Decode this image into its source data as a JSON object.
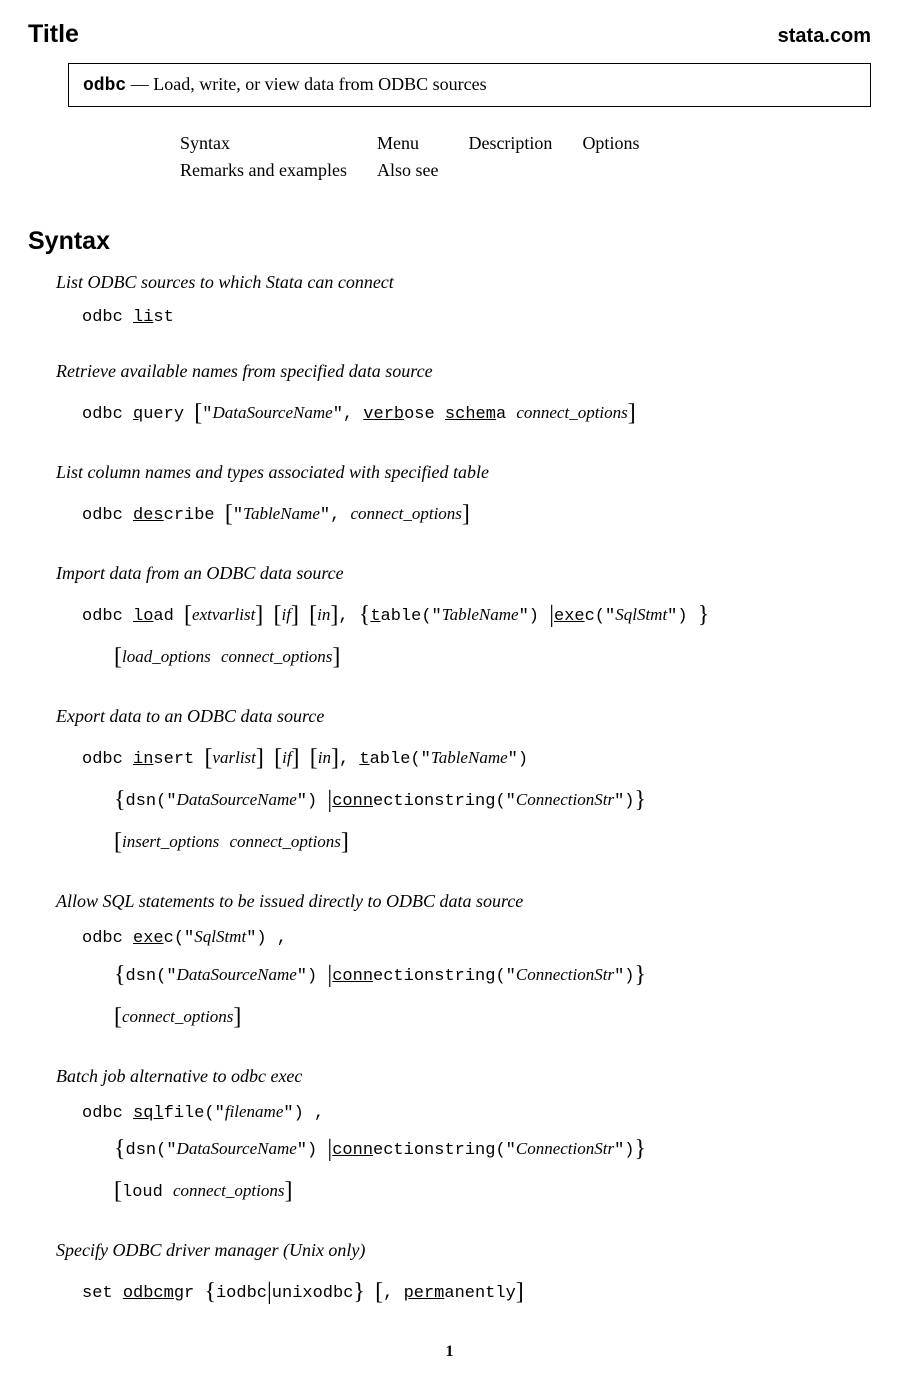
{
  "header": {
    "title": "Title",
    "brand": "stata.com"
  },
  "titleBox": {
    "cmd": "odbc",
    "dash": "—",
    "desc": "Load, write, or view data from ODBC sources"
  },
  "nav": {
    "r1c1": "Syntax",
    "r1c2": "Menu",
    "r1c3": "Description",
    "r1c4": "Options",
    "r2c1": "Remarks and examples",
    "r2c2": "Also see"
  },
  "section": "Syntax",
  "s1": {
    "desc": "List ODBC sources to which Stata can connect",
    "cmd_odbc": "odbc ",
    "cmd_li": "li",
    "cmd_st": "st"
  },
  "s2": {
    "desc": "Retrieve available names from specified data source",
    "odbc": "odbc ",
    "q": "q",
    "uery": "uery ",
    "dsn": "DataSourceName",
    "comma": ", ",
    "verb": "verb",
    "ose": "ose ",
    "schem": "schem",
    "a": "a ",
    "conn": "connect_options"
  },
  "s3": {
    "desc": "List column names and types associated with specified table",
    "odbc": "odbc ",
    "des": "des",
    "cribe": "cribe ",
    "tbl": "TableName",
    "comma": ", ",
    "conn": "connect_options"
  },
  "s4": {
    "desc": "Import data from an ODBC data source",
    "odbc": "odbc ",
    "lo": "lo",
    "ad": "ad ",
    "extv": "extvarlist",
    "if": "if",
    "in": "in",
    "comma": ", ",
    "t": "t",
    "able": "able(",
    "tbl": "TableName",
    "close": ") ",
    "exe": "exe",
    "c": "c(",
    "sql": "SqlStmt",
    "close2": ") ",
    "loadopt": "load_options",
    "connopt": "connect_options"
  },
  "s5": {
    "desc": "Export data to an ODBC data source",
    "odbc": "odbc ",
    "in": "in",
    "sert": "sert ",
    "varlist": "varlist",
    "if": "if",
    "inr": "in",
    "comma": ", ",
    "t": "t",
    "able": "able(",
    "tbl": "TableName",
    "close": ")",
    "dsn": "dsn(",
    "dsnv": "DataSourceName",
    "dsnc": ") ",
    "conn": "conn",
    "ectstr": "ectionstring(",
    "cstr": "ConnectionStr",
    "cstrc": ")",
    "insopt": "insert_options",
    "connopt": "connect_options"
  },
  "s6": {
    "desc": "Allow SQL statements to be issued directly to ODBC data source",
    "odbc": "odbc ",
    "exe": "exe",
    "c": "c(",
    "sql": "SqlStmt",
    "close": ") ,",
    "dsn": "dsn(",
    "dsnv": "DataSourceName",
    "dsnc": ") ",
    "conn": "conn",
    "ectstr": "ectionstring(",
    "cstr": "ConnectionStr",
    "cstrc": ")",
    "connopt": "connect_options"
  },
  "s7": {
    "desc": "Batch job alternative to odbc exec",
    "odbc": "odbc ",
    "sql": "sql",
    "file": "file(",
    "fn": "filename",
    "close": ") ,",
    "dsn": "dsn(",
    "dsnv": "DataSourceName",
    "dsnc": ") ",
    "conn": "conn",
    "ectstr": "ectionstring(",
    "cstr": "ConnectionStr",
    "cstrc": ")",
    "loud": "loud ",
    "connopt": "connect_options"
  },
  "s8": {
    "desc": "Specify ODBC driver manager (Unix only)",
    "set": "set ",
    "odbcmg": "odbcmg",
    "r": "r ",
    "iodbc": "iodbc",
    "unixodbc": "unixodbc",
    "comma": ", ",
    "perm": "perm",
    "anently": "anently"
  },
  "bracket": {
    "lb": "[",
    "rb": "]",
    "lc": "{",
    "rc": "}",
    "pipe": "|",
    "q": "\""
  },
  "pagenum": "1"
}
